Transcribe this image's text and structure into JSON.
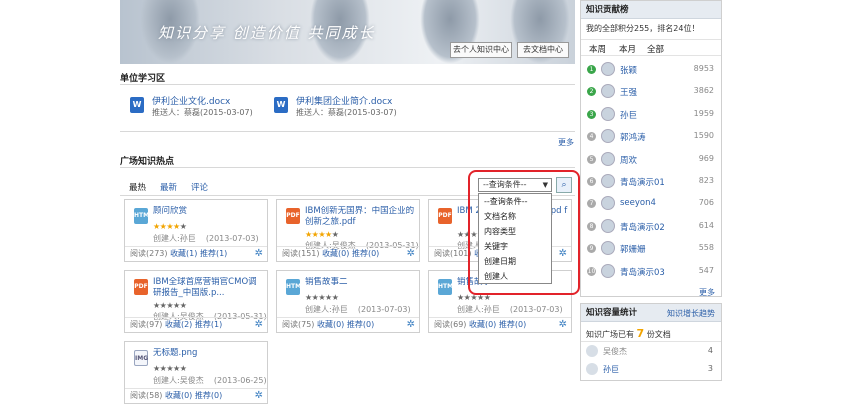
{
  "banner": {
    "slogan": "知识分享 创造价值 共同成长",
    "btn_personal": "去个人知识中心",
    "btn_docs": "去文档中心"
  },
  "unit": {
    "title": "单位学习区",
    "docs": [
      {
        "icon": "W",
        "title": "伊利企业文化.docx",
        "meta": "推送人：蔡磊(2015-03-07)"
      },
      {
        "icon": "W",
        "title": "伊利集团企业简介.docx",
        "meta": "推送人：蔡磊(2015-03-07)"
      }
    ],
    "more": "更多"
  },
  "plaza": {
    "title": "广场知识热点",
    "tabs": [
      "最热",
      "最新",
      "评论"
    ],
    "cards": [
      {
        "icon": "HTML",
        "title": "顾问欣赏",
        "stars": 4,
        "creator": "创建人:孙巨",
        "date": "(2013-07-03)",
        "reads": "阅读(273)",
        "fav": "收藏(1)",
        "rec": "推荐(1)"
      },
      {
        "icon": "PDF",
        "title": "IBM创新无国界：中国企业的创新之旅.pdf",
        "stars": 4,
        "creator": "创建人:吴俊杰",
        "date": "(2013-05-31)",
        "reads": "阅读(151)",
        "fav": "收藏(0)",
        "rec": "推荐(0)"
      },
      {
        "icon": "PDF",
        "title": "IBM 2014年回顾与展望.pd f",
        "stars": 0,
        "creator": "创建人:吴俊杰",
        "date": "",
        "reads": "阅读(101)",
        "fav": "收藏(0)",
        "rec": "推荐(0)"
      },
      {
        "icon": "PDF",
        "title": "IBM全球首席营销官CMO调研报告_中国版.p...",
        "stars": 0,
        "creator": "创建人:吴俊杰",
        "date": "(2013-05-31)",
        "reads": "阅读(97)",
        "fav": "收藏(2)",
        "rec": "推荐(1)"
      },
      {
        "icon": "HTML",
        "title": "销售故事二",
        "stars": 0,
        "creator": "创建人:孙巨",
        "date": "(2013-07-03)",
        "reads": "阅读(75)",
        "fav": "收藏(0)",
        "rec": "推荐(0)"
      },
      {
        "icon": "HTML",
        "title": "销售故事一",
        "stars": 0,
        "creator": "创建人:孙巨",
        "date": "(2013-07-03)",
        "reads": "阅读(69)",
        "fav": "收藏(0)",
        "rec": "推荐(0)"
      },
      {
        "icon": "IMG",
        "title": "无标题.png",
        "stars": 0,
        "creator": "创建人:吴俊杰",
        "date": "(2013-06-25)",
        "reads": "阅读(58)",
        "fav": "收藏(0)",
        "rec": "推荐(0)"
      }
    ],
    "query": {
      "selected": "--查询条件--",
      "options": [
        "--查询条件--",
        "文档名称",
        "内容类型",
        "关键字",
        "创建日期",
        "创建人"
      ]
    }
  },
  "ranking": {
    "title": "知识贡献榜",
    "my_points": "我的全部积分255，排名24位！",
    "tabs": [
      "本周",
      "本月",
      "全部"
    ],
    "items": [
      {
        "rank": "1",
        "name": "张颖",
        "score": "8953"
      },
      {
        "rank": "2",
        "name": "王强",
        "score": "3862"
      },
      {
        "rank": "3",
        "name": "孙巨",
        "score": "1959"
      },
      {
        "rank": "4",
        "name": "郭鸿涛",
        "score": "1590"
      },
      {
        "rank": "5",
        "name": "周欢",
        "score": "969"
      },
      {
        "rank": "6",
        "name": "青岛演示01",
        "score": "823"
      },
      {
        "rank": "7",
        "name": "seeyon4",
        "score": "706"
      },
      {
        "rank": "8",
        "name": "青岛演示02",
        "score": "614"
      },
      {
        "rank": "9",
        "name": "郭姗姗",
        "score": "558"
      },
      {
        "rank": "10",
        "name": "青岛演示03",
        "score": "547"
      }
    ],
    "more": "更多"
  },
  "stats": {
    "title": "知识容量统计",
    "trend": "知识增长趋势",
    "line_pre": "知识广场已有",
    "count": "7",
    "line_post": "份文档",
    "items": [
      {
        "name": "吴俊杰",
        "value": "4"
      },
      {
        "name": "孙巨",
        "value": "3"
      }
    ]
  },
  "colors": {
    "accent": "#2a5ea8",
    "highlight": "#e2232a",
    "star": "#f2a400"
  }
}
